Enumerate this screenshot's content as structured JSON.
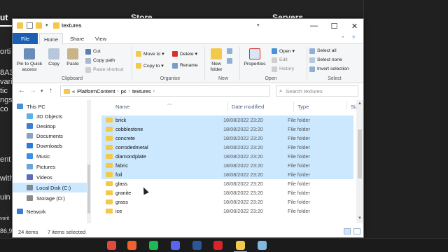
{
  "background_app": {
    "tabs": [
      {
        "label": "ut"
      },
      {
        "label": "Store"
      },
      {
        "label": "Servers"
      }
    ],
    "side_text": [
      "orti",
      "8A3",
      "vari",
      "tic",
      "ngs",
      "co",
      "ent",
      "with",
      "uin",
      "vorit",
      "86,9"
    ]
  },
  "window": {
    "title": "textures",
    "controls": {
      "minimize": "—",
      "maximize": "☐",
      "close": "✕"
    }
  },
  "ribbon_tabs": {
    "file": "File",
    "home": "Home",
    "share": "Share",
    "view": "View"
  },
  "ribbon": {
    "clipboard": {
      "pin": "Pin to Quick access",
      "copy": "Copy",
      "paste": "Paste",
      "cut": "Cut",
      "copy_path": "Copy path",
      "paste_shortcut": "Paste shortcut",
      "label": "Clipboard"
    },
    "organise": {
      "move_to": "Move to ▾",
      "copy_to": "Copy to ▾",
      "delete": "Delete ▾",
      "rename": "Rename",
      "label": "Organise"
    },
    "new": {
      "new_folder": "New folder",
      "label": "New"
    },
    "open": {
      "properties": "Properties",
      "open": "Open ▾",
      "edit": "Edit",
      "history": "History",
      "label": "Open"
    },
    "select": {
      "select_all": "Select all",
      "select_none": "Select none",
      "invert": "Invert selection",
      "label": "Select"
    }
  },
  "address": {
    "prefix": "«",
    "crumbs": [
      "PlatformContent",
      "pc",
      "textures"
    ],
    "search_placeholder": "Search textures"
  },
  "nav_pane": [
    {
      "label": "This PC",
      "icon": "pc-icon",
      "color": "#4a90d9",
      "selected": false
    },
    {
      "label": "3D Objects",
      "icon": "cube-icon",
      "color": "#5ab0e8",
      "selected": false
    },
    {
      "label": "Desktop",
      "icon": "desktop-icon",
      "color": "#3b7fd0",
      "selected": false
    },
    {
      "label": "Documents",
      "icon": "documents-icon",
      "color": "#8aa4c0",
      "selected": false
    },
    {
      "label": "Downloads",
      "icon": "download-icon",
      "color": "#2d7bd6",
      "selected": false
    },
    {
      "label": "Music",
      "icon": "music-icon",
      "color": "#3a8ee6",
      "selected": false
    },
    {
      "label": "Pictures",
      "icon": "pictures-icon",
      "color": "#6aa6dc",
      "selected": false
    },
    {
      "label": "Videos",
      "icon": "videos-icon",
      "color": "#5c6bc0",
      "selected": false
    },
    {
      "label": "Local Disk (C:)",
      "icon": "disk-icon",
      "color": "#7a8a9a",
      "selected": true
    },
    {
      "label": "Storage (D:)",
      "icon": "drive-icon",
      "color": "#8a8a8a",
      "selected": false
    },
    {
      "label": "Network",
      "icon": "network-icon",
      "color": "#3a7bd5",
      "selected": false
    }
  ],
  "columns": {
    "name": "Name",
    "date": "Date modified",
    "type": "Type",
    "size": "Size"
  },
  "files": [
    {
      "name": "brick",
      "date": "18/08/2022 23:20",
      "type": "File folder",
      "selected": true
    },
    {
      "name": "cobblestone",
      "date": "18/08/2022 23:20",
      "type": "File folder",
      "selected": true
    },
    {
      "name": "concrete",
      "date": "18/08/2022 23:20",
      "type": "File folder",
      "selected": true
    },
    {
      "name": "corrodedmetal",
      "date": "18/08/2022 23:20",
      "type": "File folder",
      "selected": true
    },
    {
      "name": "diamondplate",
      "date": "18/08/2022 23:20",
      "type": "File folder",
      "selected": true
    },
    {
      "name": "fabric",
      "date": "18/08/2022 23:20",
      "type": "File folder",
      "selected": true
    },
    {
      "name": "foil",
      "date": "18/08/2022 23:20",
      "type": "File folder",
      "selected": true
    },
    {
      "name": "glass",
      "date": "18/08/2022 23:20",
      "type": "File folder",
      "selected": false
    },
    {
      "name": "granite",
      "date": "18/08/2022 23:20",
      "type": "File folder",
      "selected": false
    },
    {
      "name": "grass",
      "date": "18/08/2022 23:20",
      "type": "File folder",
      "selected": false
    },
    {
      "name": "ice",
      "date": "18/08/2022 23:20",
      "type": "File folder",
      "selected": false
    }
  ],
  "status": {
    "items": "24 items",
    "selected": "7 items selected"
  },
  "taskbar_apps": [
    {
      "icon": "chrome-icon",
      "color": "#e04a3b"
    },
    {
      "icon": "brave-icon",
      "color": "#f0622d"
    },
    {
      "icon": "spotify-icon",
      "color": "#1db954"
    },
    {
      "icon": "app-icon",
      "color": "#5865f2"
    },
    {
      "icon": "editor-icon",
      "color": "#2b5797"
    },
    {
      "icon": "amd-icon",
      "color": "#d9252a"
    },
    {
      "icon": "explorer-icon",
      "color": "#f3c94b"
    },
    {
      "icon": "notes-icon",
      "color": "#7fb8e0"
    }
  ]
}
